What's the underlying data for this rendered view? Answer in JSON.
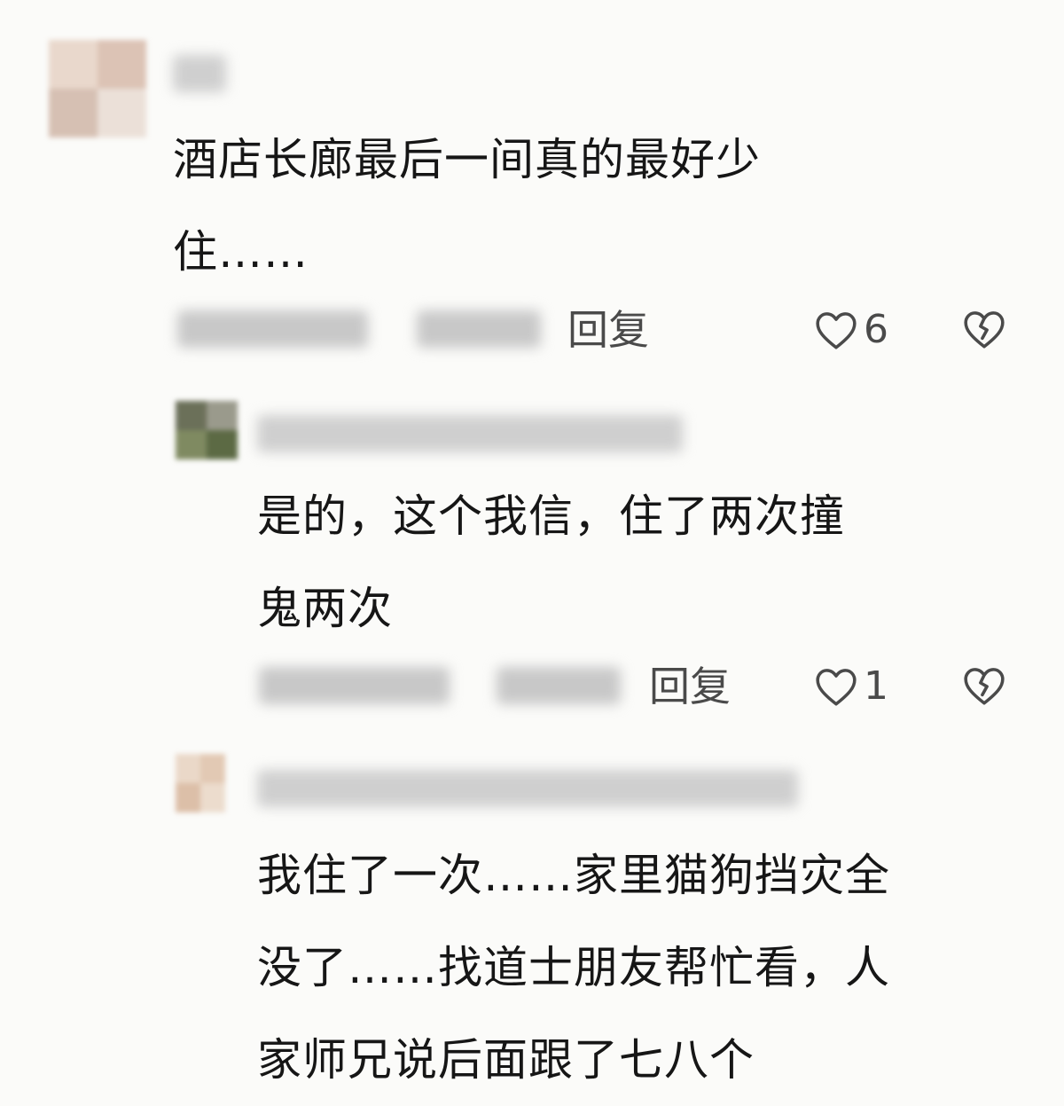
{
  "comments": [
    {
      "lines": [
        "酒店长廊最后一间真的最好少",
        "住……"
      ],
      "reply_label": "回复",
      "like_count": "6",
      "like_icon": "heart-outline-icon",
      "dislike_icon": "broken-heart-icon"
    },
    {
      "lines": [
        "是的，这个我信，住了两次撞",
        "鬼两次"
      ],
      "reply_label": "回复",
      "like_count": "1",
      "like_icon": "heart-outline-icon",
      "dislike_icon": "broken-heart-icon"
    },
    {
      "lines": [
        "我住了一次……家里猫狗挡灾全",
        "没了……找道士朋友帮忙看，人",
        "家师兄说后面跟了七八个"
      ]
    }
  ]
}
